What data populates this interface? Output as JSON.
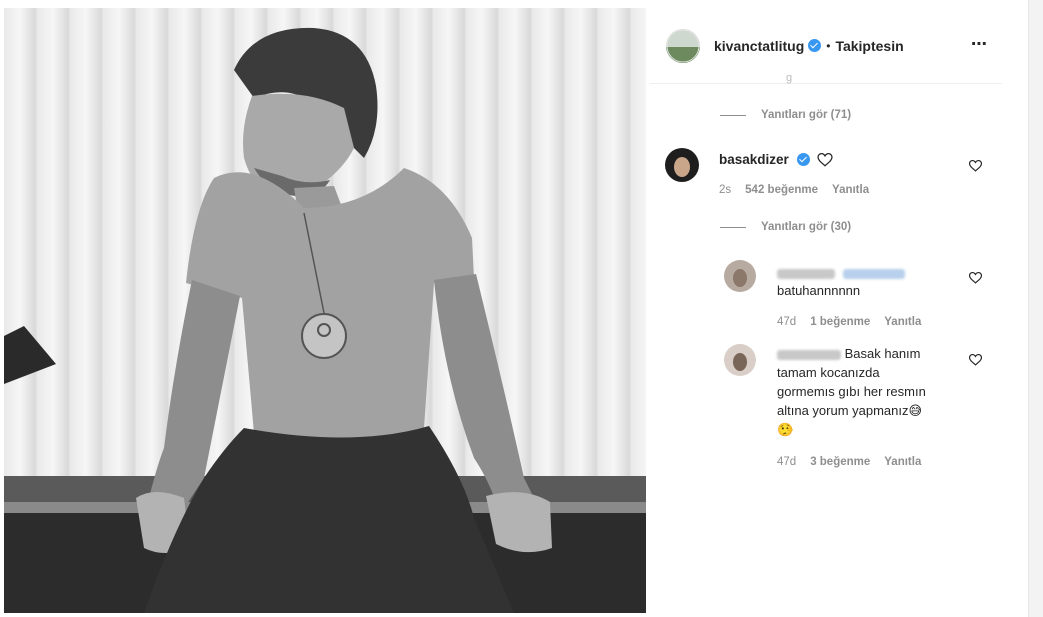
{
  "post": {
    "author": "kivanctatlitug",
    "separator": "•",
    "follow_status": "Takiptesin",
    "more_icon": "⋯"
  },
  "view_replies_1": "Yanıtları gör (71)",
  "comment_main": {
    "username": "basakdizer",
    "text_icon": "heart-outline-icon",
    "time": "2s",
    "likes": "542 beğenme",
    "reply": "Yanıtla",
    "view_replies": "Yanıtları gör (30)"
  },
  "replies": [
    {
      "text": "batuhannnnnn",
      "time": "47d",
      "likes": "1 beğenme",
      "reply": "Yanıtla"
    },
    {
      "text_line1": "Basak hanım",
      "text_line2": "tamam kocanızda",
      "text_line3": "gormemıs gıbı her resmın",
      "text_line4": "altına yorum yapmanız",
      "emoji1": "😅",
      "emoji2": "🤥",
      "time": "47d",
      "likes": "3 beğenme",
      "reply": "Yanıtla"
    }
  ],
  "colors": {
    "verified": "#3897f0",
    "meta": "#8e8e8e",
    "text": "#262626"
  }
}
